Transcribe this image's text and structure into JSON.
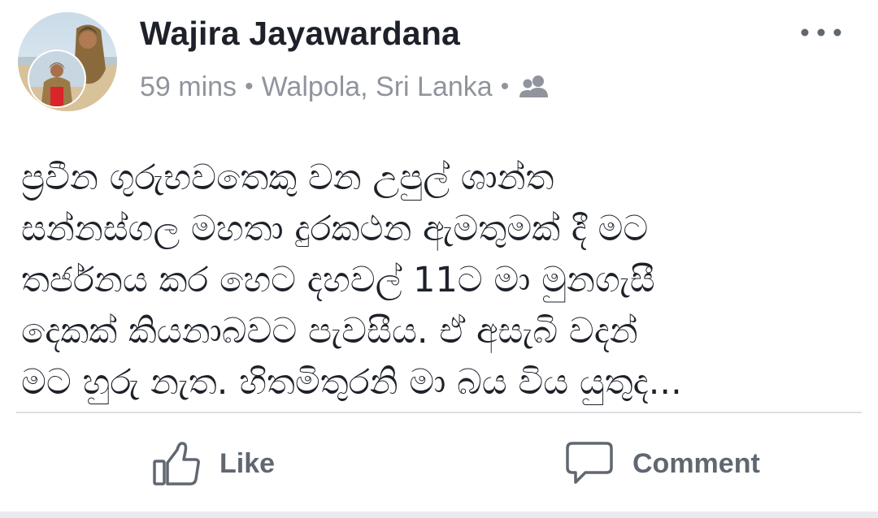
{
  "post": {
    "author": "Wajira Jayawardana",
    "time": "59 mins",
    "separator": "•",
    "location": "Walpola, Sri Lanka",
    "audience_icon": "friends-icon",
    "more_icon": "more-options-icon",
    "text_lines": [
      "ප්‍රවීන ගුරුභවතෙකු වන උපුල් ශාන්ත",
      "සන්නස්ගල මහතා දුරකථන ඇමතුමක් දී මට",
      "තර්ජනය කර හෙට දහවල් 11ට මා මුනගැසී",
      "දෙකක් කියනාබවට පැවසීය. ඒ අසැබි වදන්",
      "මට හුරු නැත. හිතමිතුරනි මා බය විය යුතුද..."
    ]
  },
  "actions": {
    "like_label": "Like",
    "like_icon": "thumbs-up-icon",
    "comment_label": "Comment",
    "comment_icon": "comment-icon"
  },
  "colors": {
    "name": "#1d2129",
    "meta": "#90949c",
    "action": "#606770",
    "divider": "#dddfe2"
  }
}
